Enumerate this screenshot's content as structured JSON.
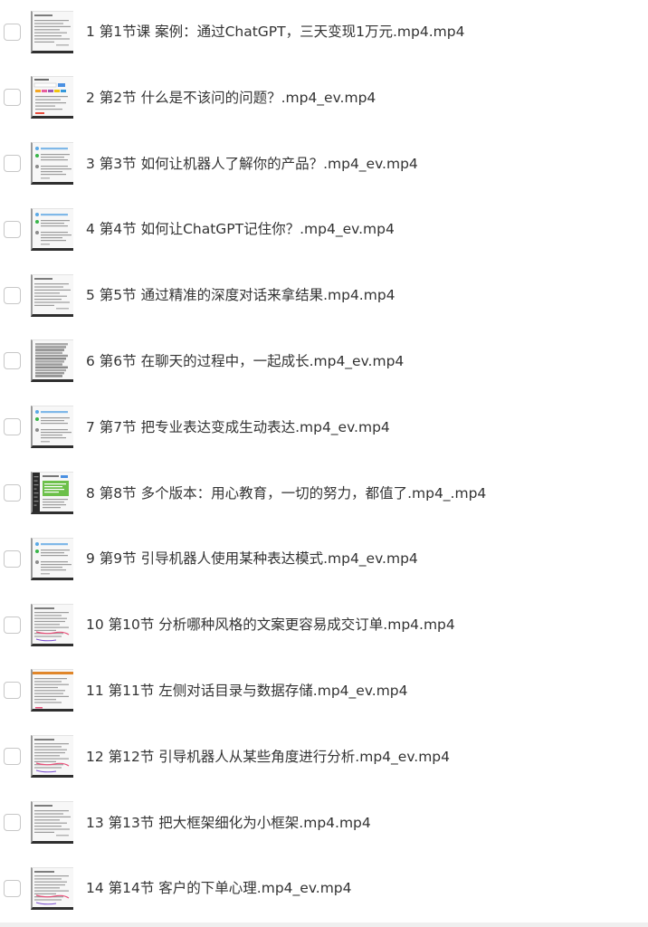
{
  "files": [
    {
      "name": "1 第1节课 案例：通过ChatGPT，三天变现1万元.mp4.mp4",
      "thumb": "doc"
    },
    {
      "name": "2 第2节 什么是不该问的问题？.mp4_ev.mp4",
      "thumb": "colorful"
    },
    {
      "name": "3 第3节 如何让机器人了解你的产品？.mp4_ev.mp4",
      "thumb": "chat"
    },
    {
      "name": "4 第4节 如何让ChatGPT记住你？.mp4_ev.mp4",
      "thumb": "chat"
    },
    {
      "name": "5 第5节 通过精准的深度对话来拿结果.mp4.mp4",
      "thumb": "doc"
    },
    {
      "name": "6 第6节 在聊天的过程中，一起成长.mp4_ev.mp4",
      "thumb": "dense"
    },
    {
      "name": "7 第7节 把专业表达变成生动表达.mp4_ev.mp4",
      "thumb": "chat"
    },
    {
      "name": "8 第8节 多个版本：用心教育，一切的努力，都值了.mp4_.mp4",
      "thumb": "app"
    },
    {
      "name": "9 第9节 引导机器人使用某种表达模式.mp4_ev.mp4",
      "thumb": "chat"
    },
    {
      "name": "10 第10节 分析哪种风格的文案更容易成交订单.mp4.mp4",
      "thumb": "annotated"
    },
    {
      "name": "11 第11节 左侧对话目录与数据存储.mp4_ev.mp4",
      "thumb": "banner"
    },
    {
      "name": "12 第12节 引导机器人从某些角度进行分析.mp4_ev.mp4",
      "thumb": "annotated"
    },
    {
      "name": "13 第13节 把大框架细化为小框架.mp4.mp4",
      "thumb": "doc"
    },
    {
      "name": "14 第14节 客户的下单心理.mp4_ev.mp4",
      "thumb": "annotated"
    }
  ]
}
